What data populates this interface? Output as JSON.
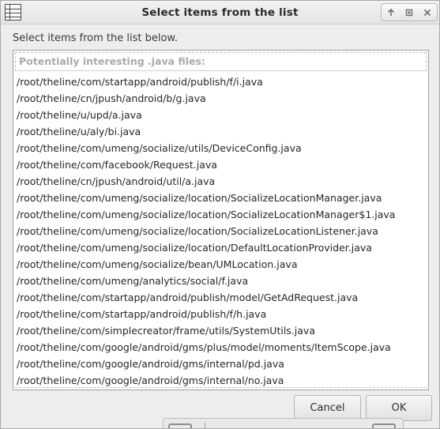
{
  "dialog": {
    "title": "Select items from the list",
    "instruction": "Select items from the list below.",
    "list_header": "Potentially interesting .java files:",
    "items": [
      "/root/theline/com/startapp/android/publish/f/i.java",
      "/root/theline/cn/jpush/android/b/g.java",
      "/root/theline/u/upd/a.java",
      "/root/theline/u/aly/bi.java",
      "/root/theline/com/umeng/socialize/utils/DeviceConfig.java",
      "/root/theline/com/facebook/Request.java",
      "/root/theline/cn/jpush/android/util/a.java",
      "/root/theline/com/umeng/socialize/location/SocializeLocationManager.java",
      "/root/theline/com/umeng/socialize/location/SocializeLocationManager$1.java",
      "/root/theline/com/umeng/socialize/location/SocializeLocationListener.java",
      "/root/theline/com/umeng/socialize/location/DefaultLocationProvider.java",
      "/root/theline/com/umeng/socialize/bean/UMLocation.java",
      "/root/theline/com/umeng/analytics/social/f.java",
      "/root/theline/com/startapp/android/publish/model/GetAdRequest.java",
      "/root/theline/com/startapp/android/publish/f/h.java",
      "/root/theline/com/simplecreator/frame/utils/SystemUtils.java",
      "/root/theline/com/google/android/gms/plus/model/moments/ItemScope.java",
      "/root/theline/com/google/android/gms/internal/pd.java",
      "/root/theline/com/google/android/gms/internal/no.java"
    ],
    "cancel_label": "Cancel",
    "ok_label": "OK"
  },
  "icons": {
    "app": "window-list-icon",
    "controls": [
      "maximize-up-icon",
      "restore-icon",
      "close-icon"
    ],
    "background": [
      "folder-icon",
      "folder-icon"
    ]
  }
}
